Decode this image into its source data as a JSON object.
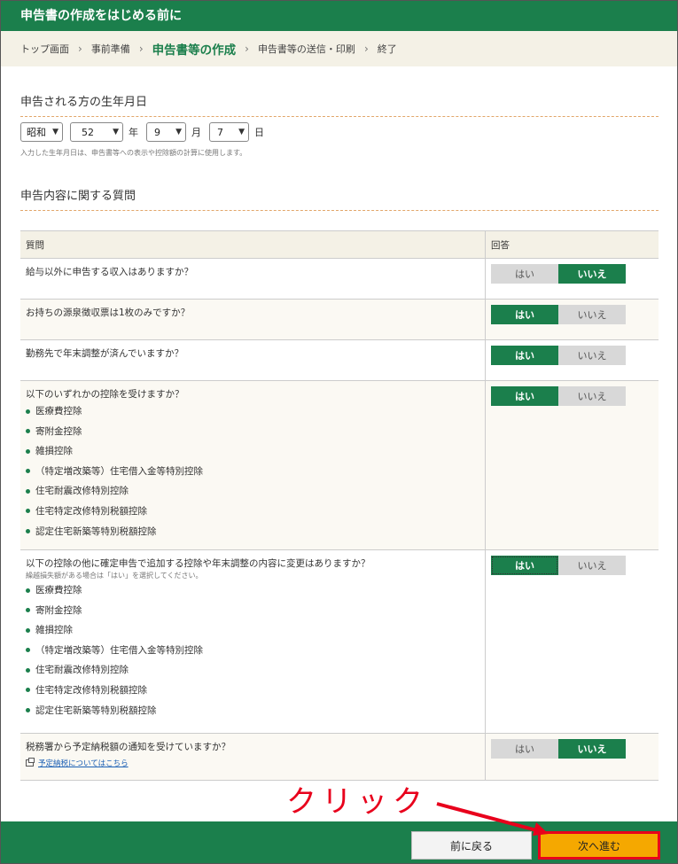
{
  "title": "申告書の作成をはじめる前に",
  "breadcrumb": [
    "トップ画面",
    "事前準備",
    "申告書等の作成",
    "申告書等の送信・印刷",
    "終了"
  ],
  "breadcrumb_current_index": 2,
  "dob": {
    "heading": "申告される方の生年月日",
    "era": "昭和",
    "year": "52",
    "year_unit": "年",
    "month": "9",
    "month_unit": "月",
    "day": "7",
    "day_unit": "日",
    "note": "入力した生年月日は、申告書等への表示や控除額の計算に使用します。"
  },
  "questions": {
    "heading": "申告内容に関する質問",
    "col_question": "質問",
    "col_answer": "回答",
    "yes": "はい",
    "no": "いいえ",
    "rows": [
      {
        "text": "給与以外に申告する収入はありますか？",
        "answer": "no"
      },
      {
        "text": "お持ちの源泉徴収票は1枚のみですか？",
        "answer": "yes"
      },
      {
        "text": "勤務先で年末調整が済んでいますか？",
        "answer": "yes"
      },
      {
        "text": "以下のいずれかの控除を受けますか？",
        "answer": "yes",
        "items": [
          "医療費控除",
          "寄附金控除",
          "雑損控除",
          "（特定増改築等）住宅借入金等特別控除",
          "住宅耐震改修特別控除",
          "住宅特定改修特別税額控除",
          "認定住宅新築等特別税額控除"
        ]
      },
      {
        "text": "以下の控除の他に確定申告で追加する控除や年末調整の内容に変更はありますか？",
        "answer": "yes",
        "subnote": "繰越損失額がある場合は「はい」を選択してください。",
        "items": [
          "医療費控除",
          "寄附金控除",
          "雑損控除",
          "（特定増改築等）住宅借入金等特別控除",
          "住宅耐震改修特別控除",
          "住宅特定改修特別税額控除",
          "認定住宅新築等特別税額控除"
        ]
      },
      {
        "text": "税務署から予定納税額の通知を受けていますか？",
        "answer": "no",
        "link": "予定納税についてはこちら"
      }
    ]
  },
  "footer": {
    "back": "前に戻る",
    "next": "次へ進む"
  },
  "annotation": {
    "text": "クリック",
    "color": "#e8001c"
  },
  "colors": {
    "primary": "#1b7f4c",
    "next_button": "#f5a800",
    "header_bg": "#f4f1e6"
  }
}
